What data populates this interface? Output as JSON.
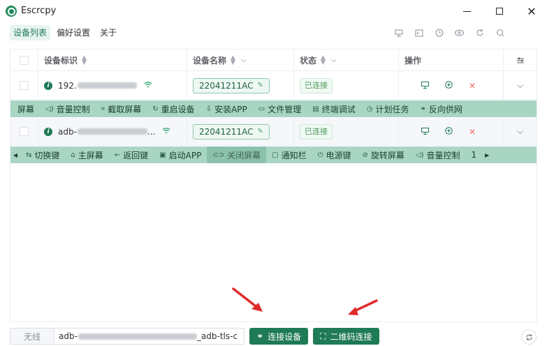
{
  "window": {
    "title": "Escrcpy"
  },
  "menu": {
    "tabs": [
      "设备列表",
      "偏好设置",
      "关于"
    ]
  },
  "table": {
    "headers": {
      "serial": "设备标识",
      "name": "设备名称",
      "status": "状态",
      "ops": "操作"
    },
    "rows": [
      {
        "serial_prefix": "192.",
        "name": "22041211AC",
        "status": "已连接"
      },
      {
        "serial_prefix": "adb-",
        "serial_suffix": "...",
        "name": "22041211AC",
        "status": "已连接"
      }
    ]
  },
  "actions_row1": [
    "屏幕",
    "音量控制",
    "截取屏幕",
    "重启设备",
    "安装APP",
    "文件管理",
    "终端调试",
    "计划任务",
    "反向供网"
  ],
  "actions_row2": [
    "切换键",
    "主屏幕",
    "返回键",
    "启动APP",
    "关闭屏幕",
    "通知栏",
    "电源键",
    "旋转屏幕",
    "音量控制",
    "1"
  ],
  "footer": {
    "wifi_label": "无线",
    "address_prefix": "adb-",
    "address_suffix": "_adb-tls-c",
    "connect_button": "连接设备",
    "qr_button": "二维码连接"
  },
  "colors": {
    "accent": "#1f7a56",
    "actions_bar": "#a8d6c3",
    "arrow": "#e02b2b"
  }
}
